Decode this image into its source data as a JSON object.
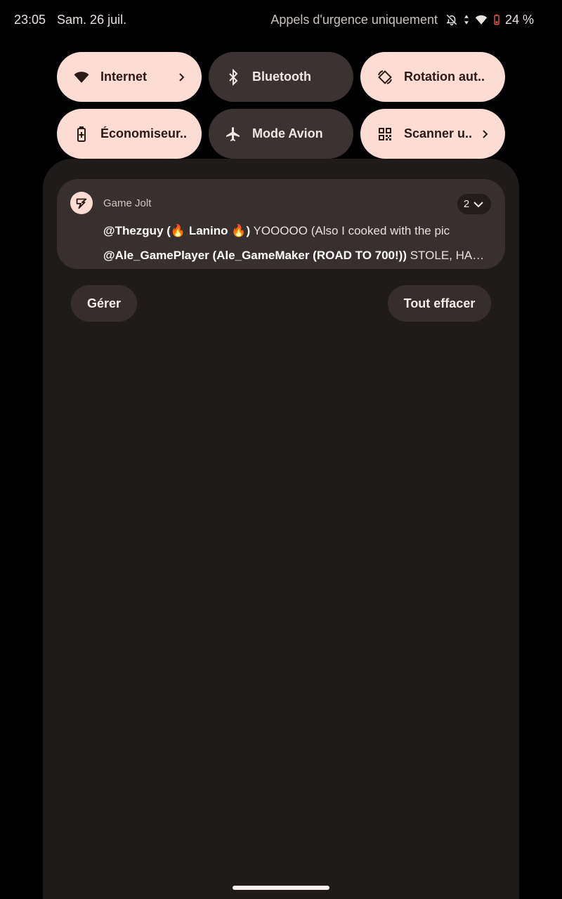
{
  "status_bar": {
    "time": "23:05",
    "date": "Sam. 26 juil.",
    "emergency": "Appels d'urgence uniquement",
    "battery": "24 %",
    "icons": [
      "bell-off-icon",
      "data-arrows-icon",
      "wifi-icon",
      "battery-icon"
    ]
  },
  "tiles": [
    {
      "label": "Internet",
      "icon": "wifi-icon",
      "state": "on",
      "has_chevron": true
    },
    {
      "label": "Bluetooth",
      "icon": "bluetooth-icon",
      "state": "off",
      "has_chevron": false
    },
    {
      "label": "Rotation aut..",
      "icon": "rotation-icon",
      "state": "on",
      "has_chevron": false
    },
    {
      "label": "Économiseur..",
      "icon": "battery-saver-icon",
      "state": "on",
      "has_chevron": false
    },
    {
      "label": "Mode Avion",
      "icon": "airplane-icon",
      "state": "off",
      "has_chevron": false
    },
    {
      "label": "Scanner u..",
      "icon": "qr-code-icon",
      "state": "on",
      "has_chevron": true
    }
  ],
  "notification": {
    "app_name": "Game Jolt",
    "count": "2",
    "line1_sender_a": "@Thezguy (",
    "line1_emoji_a": "🔥",
    "line1_sender_b": " Lanino ",
    "line1_emoji_b": "🔥",
    "line1_sender_c": ")",
    "line1_text": " YOOOOO (Also I cooked with the pic",
    "line2_sender": "@Ale_GamePlayer (Ale_GameMaker (ROAD TO 700!))",
    "line2_text": " STOLE, HAH..."
  },
  "actions": {
    "manage": "Gérer",
    "clear_all": "Tout effacer"
  },
  "colors": {
    "tile_on": "#fddcd4",
    "tile_off": "#3a3332",
    "panel": "#201b1b",
    "notification_bg": "#38302f",
    "battery_low": "#e0533f"
  }
}
